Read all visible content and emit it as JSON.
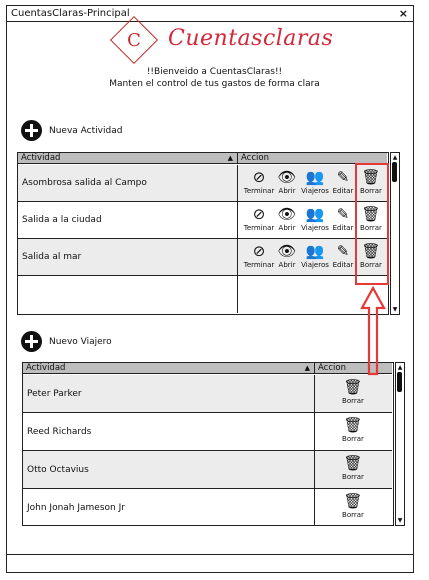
{
  "window": {
    "title": "CuentasClaras-Principal",
    "close_glyph": "×"
  },
  "header": {
    "logo_letter": "C",
    "app_name": "Cuentasclaras",
    "welcome": "!!Bienveido a CuentasClaras!!",
    "subtitle": "Manten el control de tus gastos de forma clara",
    "brand_color": "#d3273a"
  },
  "activities": {
    "add_label": "Nueva Actividad",
    "columns": [
      "Actividad",
      "Accion"
    ],
    "sort_glyph": "▲",
    "rows": [
      {
        "name": "Asombrosa salida al Campo"
      },
      {
        "name": "Salida a la ciudad"
      },
      {
        "name": "Salida al mar"
      },
      {
        "name": ""
      }
    ],
    "actions": [
      {
        "label": "Terminar",
        "icon": "ban-icon",
        "glyph": "⊘"
      },
      {
        "label": "Abrir",
        "icon": "eye-icon",
        "glyph": "👁"
      },
      {
        "label": "Viajeros",
        "icon": "users-icon",
        "glyph": "👥"
      },
      {
        "label": "Editar",
        "icon": "pencil-icon",
        "glyph": "✎"
      },
      {
        "label": "Borrar",
        "icon": "trash-icon",
        "glyph": "🗑"
      }
    ]
  },
  "travelers": {
    "add_label": "Nuevo Viajero",
    "columns": [
      "Actividad",
      "Accion"
    ],
    "sort_glyph": "▲",
    "rows": [
      {
        "name": "Peter Parker",
        "action": "Borrar"
      },
      {
        "name": "Reed Richards",
        "action": "Borrar"
      },
      {
        "name": "Otto Octavius",
        "action": "Borrar"
      },
      {
        "name": "John Jonah Jameson Jr",
        "action": "Borrar"
      }
    ]
  },
  "annotation": {
    "color": "#e53935"
  }
}
